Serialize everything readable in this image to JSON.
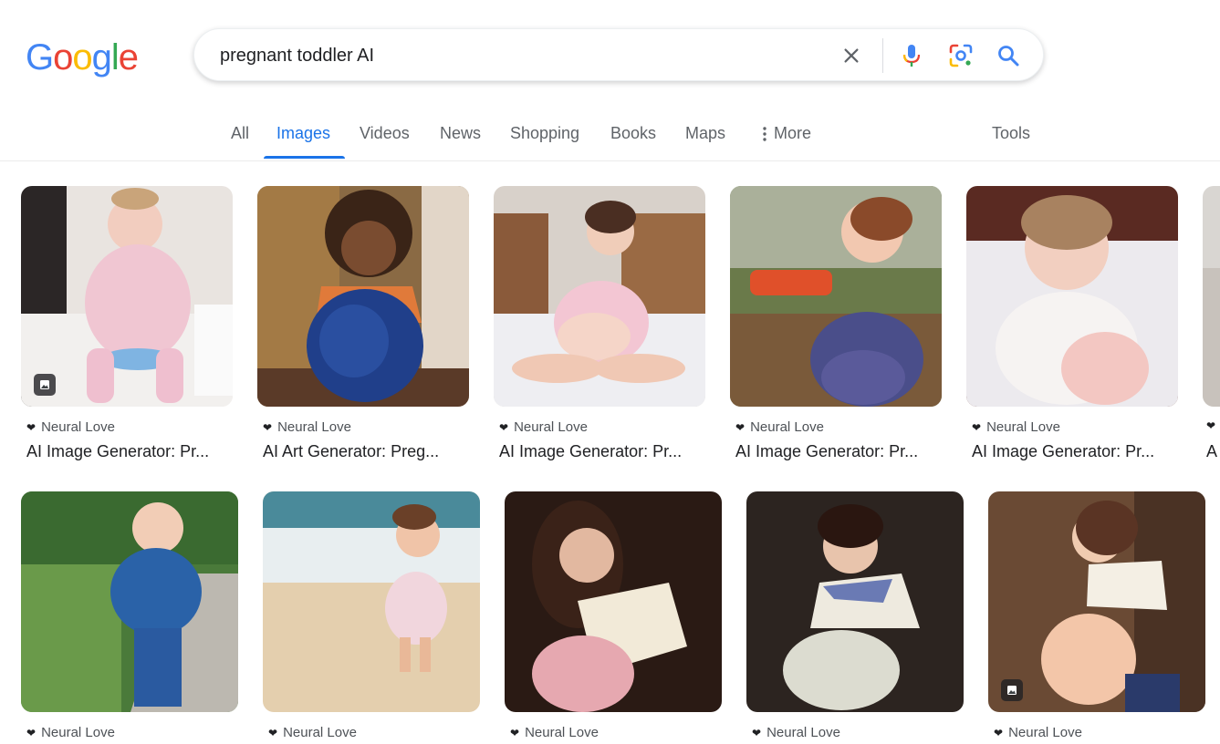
{
  "logo": [
    "G",
    "o",
    "o",
    "g",
    "l",
    "e"
  ],
  "logo_colors": [
    "#4285F4",
    "#EA4335",
    "#FBBC05",
    "#4285F4",
    "#34A853",
    "#EA4335"
  ],
  "search": {
    "query": "pregnant toddler AI"
  },
  "tabs": [
    {
      "label": "All"
    },
    {
      "label": "Images"
    },
    {
      "label": "Videos"
    },
    {
      "label": "News"
    },
    {
      "label": "Shopping"
    },
    {
      "label": "Books"
    },
    {
      "label": "Maps"
    },
    {
      "label": "More"
    }
  ],
  "tools_label": "Tools",
  "row1": [
    {
      "source": "Neural Love",
      "title": "AI Image Generator: Pr..."
    },
    {
      "source": "Neural Love",
      "title": "AI Art Generator: Preg..."
    },
    {
      "source": "Neural Love",
      "title": "AI Image Generator: Pr..."
    },
    {
      "source": "Neural Love",
      "title": "AI Image Generator: Pr..."
    },
    {
      "source": "Neural Love",
      "title": "AI Image Generator: Pr..."
    },
    {
      "source": "",
      "title": "A"
    }
  ],
  "row2": [
    {
      "source": "Neural Love"
    },
    {
      "source": "Neural Love"
    },
    {
      "source": "Neural Love"
    },
    {
      "source": "Neural Love"
    },
    {
      "source": "Neural Love"
    }
  ],
  "colors": {
    "accent": "#1a73e8",
    "tab_text": "#5f6368"
  }
}
